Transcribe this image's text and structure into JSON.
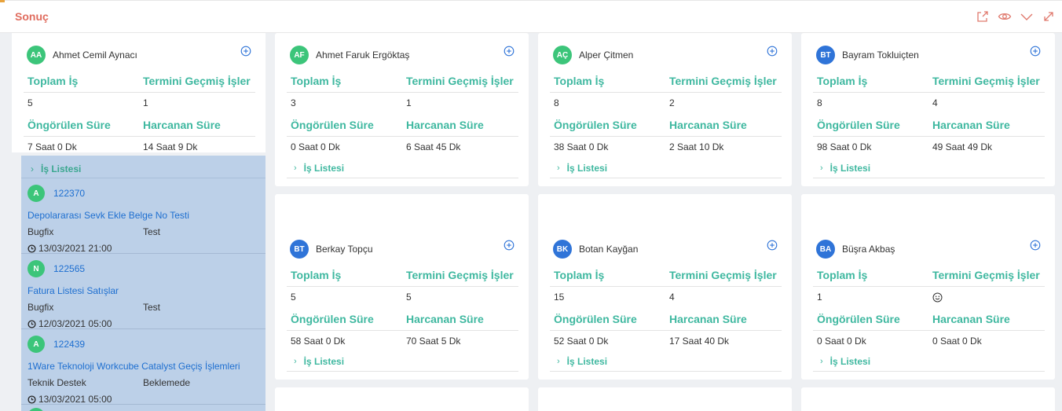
{
  "header": {
    "title": "Sonuç"
  },
  "labels": {
    "total": "Toplam İş",
    "overdue": "Termini Geçmiş İşler",
    "estimated": "Öngörülen Süre",
    "spent": "Harcanan Süre",
    "list": "İş Listesi"
  },
  "colors": {
    "teal": "#3fb8a0",
    "title_red": "#e06c5e",
    "green_avatar": "#3cc57a",
    "blue_avatar": "#2f74d8",
    "task_panel": "#bcd0e8"
  },
  "people": [
    {
      "initials": "AA",
      "name": "Ahmet Cemil Aynacı",
      "total": "5",
      "overdue": "1",
      "estimated": "7 Saat 0 Dk",
      "spent": "14 Saat 9 Dk"
    },
    {
      "initials": "AF",
      "name": "Ahmet Faruk Ergöktaş",
      "total": "3",
      "overdue": "1",
      "estimated": "0 Saat 0 Dk",
      "spent": "6 Saat 45 Dk"
    },
    {
      "initials": "AÇ",
      "name": "Alper Çitmen",
      "total": "8",
      "overdue": "2",
      "estimated": "38 Saat 0 Dk",
      "spent": "2 Saat 10 Dk"
    },
    {
      "initials": "BT",
      "name": "Bayram Tokluiçten",
      "total": "8",
      "overdue": "4",
      "estimated": "98 Saat 0 Dk",
      "spent": "49 Saat 49 Dk"
    },
    {
      "initials": "BT",
      "name": "Berkay Topçu",
      "total": "5",
      "overdue": "5",
      "estimated": "58 Saat 0 Dk",
      "spent": "70 Saat 5 Dk"
    },
    {
      "initials": "BK",
      "name": "Botan Kayğan",
      "total": "15",
      "overdue": "4",
      "estimated": "52 Saat 0 Dk",
      "spent": "17 Saat 40 Dk"
    },
    {
      "initials": "BA",
      "name": "Büşra Akbaş",
      "total": "1",
      "overdue": "",
      "estimated": "0 Saat 0 Dk",
      "spent": "0 Saat 0 Dk"
    }
  ],
  "tasks": [
    {
      "initial": "A",
      "id": "122370",
      "title": "Depolararası Sevk Ekle Belge No Testi",
      "category": "Bugfix",
      "status": "Test",
      "date": "13/03/2021 21:00"
    },
    {
      "initial": "N",
      "id": "122565",
      "title": "Fatura Listesi Satışlar",
      "category": "Bugfix",
      "status": "Test",
      "date": "12/03/2021 05:00"
    },
    {
      "initial": "A",
      "id": "122439",
      "title": "1Ware Teknoloji Workcube Catalyst Geçiş İşlemleri",
      "category": "Teknik Destek",
      "status": "Beklemede",
      "date": "13/03/2021 05:00"
    }
  ]
}
